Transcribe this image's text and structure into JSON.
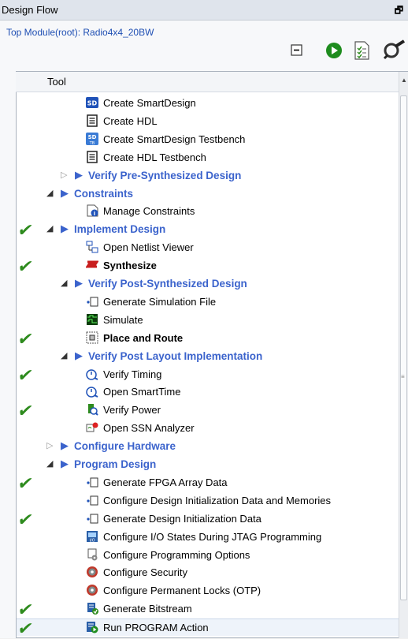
{
  "panel": {
    "title": "Design Flow",
    "pin_icon": "pin-icon"
  },
  "toolbar": {
    "top_module": "Top Module(root): Radio4x4_20BW",
    "icons": [
      "collapse-all-icon",
      "run-icon",
      "report-icon",
      "tools-icon"
    ]
  },
  "tree": {
    "header": "Tool",
    "rows": [
      {
        "label": "Create SmartDesign",
        "icon": "smartdesign-icon",
        "style": "normal"
      },
      {
        "label": "Create HDL",
        "icon": "hdl-file-icon",
        "style": "normal"
      },
      {
        "label": "Create SmartDesign Testbench",
        "icon": "smartdesign-testbench-icon",
        "style": "normal"
      },
      {
        "label": "Create HDL Testbench",
        "icon": "hdl-file-icon",
        "style": "normal"
      },
      {
        "label": "Verify Pre-Synthesized Design",
        "icon": "group-arrow-icon",
        "style": "group",
        "expand": "collapsed"
      },
      {
        "label": "Constraints",
        "icon": "group-arrow-icon",
        "style": "group",
        "expand": "expanded"
      },
      {
        "label": "Manage Constraints",
        "icon": "manage-constraints-icon",
        "style": "normal"
      },
      {
        "label": "Implement Design",
        "icon": "group-arrow-icon",
        "style": "group",
        "expand": "expanded",
        "check": true
      },
      {
        "label": "Open Netlist Viewer",
        "icon": "netlist-viewer-icon",
        "style": "normal"
      },
      {
        "label": "Synthesize",
        "icon": "synthesize-icon",
        "style": "bold",
        "check": true
      },
      {
        "label": "Verify Post-Synthesized Design",
        "icon": "group-arrow-icon",
        "style": "group",
        "expand": "expanded"
      },
      {
        "label": "Generate Simulation File",
        "icon": "generate-file-icon",
        "style": "normal"
      },
      {
        "label": "Simulate",
        "icon": "simulate-icon",
        "style": "normal"
      },
      {
        "label": "Place and Route",
        "icon": "place-route-icon",
        "style": "bold",
        "check": true
      },
      {
        "label": "Verify Post Layout Implementation",
        "icon": "group-arrow-icon",
        "style": "group",
        "expand": "expanded"
      },
      {
        "label": "Verify Timing",
        "icon": "timing-icon",
        "style": "normal",
        "check": true
      },
      {
        "label": "Open SmartTime",
        "icon": "timing-icon",
        "style": "normal"
      },
      {
        "label": "Verify Power",
        "icon": "power-icon",
        "style": "normal",
        "check": true
      },
      {
        "label": "Open SSN Analyzer",
        "icon": "ssn-analyzer-icon",
        "style": "normal"
      },
      {
        "label": "Configure Hardware",
        "icon": "group-arrow-icon",
        "style": "group",
        "expand": "collapsed"
      },
      {
        "label": "Program Design",
        "icon": "group-arrow-icon",
        "style": "group",
        "expand": "expanded"
      },
      {
        "label": "Generate FPGA Array Data",
        "icon": "generate-file-icon",
        "style": "normal",
        "check": true
      },
      {
        "label": "Configure Design Initialization Data and Memories",
        "icon": "generate-file-icon",
        "style": "normal"
      },
      {
        "label": "Generate Design Initialization Data",
        "icon": "generate-file-icon",
        "style": "normal",
        "check": true
      },
      {
        "label": "Configure I/O States During JTAG Programming",
        "icon": "io-states-icon",
        "style": "normal"
      },
      {
        "label": "Configure Programming Options",
        "icon": "programming-options-icon",
        "style": "normal"
      },
      {
        "label": "Configure Security",
        "icon": "security-icon",
        "style": "normal"
      },
      {
        "label": "Configure Permanent Locks (OTP)",
        "icon": "security-icon",
        "style": "normal"
      },
      {
        "label": "Generate Bitstream",
        "icon": "bitstream-icon",
        "style": "normal",
        "check": true
      },
      {
        "label": "Run PROGRAM Action",
        "icon": "run-program-icon",
        "style": "normal",
        "check": true,
        "selected": true
      }
    ]
  },
  "colors": {
    "group_text": "#3b63cc",
    "check": "#2e8b1e",
    "top_module_text": "#1f4fb3"
  }
}
